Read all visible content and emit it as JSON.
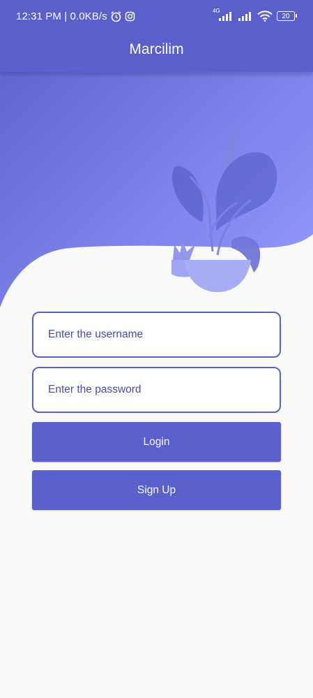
{
  "status_bar": {
    "time_net": "12:31 PM | 0.0KB/s",
    "network_type": "4G",
    "battery_level": "20",
    "icons": [
      "alarm-icon",
      "instagram-icon",
      "signal-icon",
      "signal-icon",
      "wifi-icon",
      "battery-icon"
    ]
  },
  "app_bar": {
    "title": "Marcilim"
  },
  "login_form": {
    "username_placeholder": "Enter the username",
    "password_placeholder": "Enter the password",
    "login_label": "Login",
    "signup_label": "Sign Up"
  },
  "theme": {
    "primary": "#5a5fcb",
    "gradient_start": "#5a5fcb",
    "gradient_end": "#8e93f6",
    "background": "#fafafa"
  }
}
